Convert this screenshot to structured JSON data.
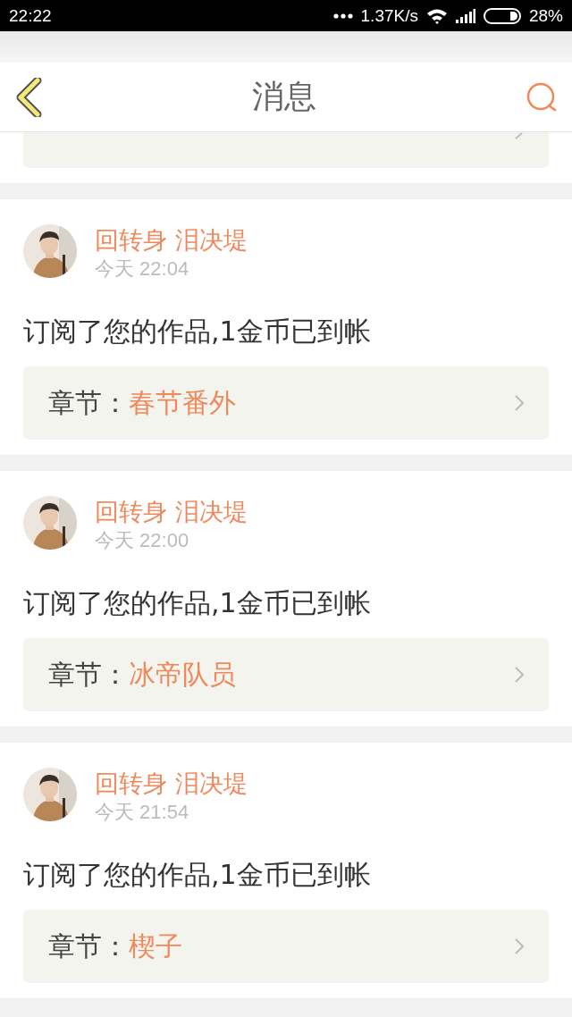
{
  "status_bar": {
    "time": "22:22",
    "network_speed": "1.37K/s",
    "battery": "28%"
  },
  "header": {
    "title": "消息"
  },
  "messages": [
    {
      "user": "回转身 泪决堤",
      "time": "今天 22:04",
      "text": "订阅了您的作品,1金币已到帐",
      "chapter_label": "章节：",
      "chapter_title": "春节番外"
    },
    {
      "user": "回转身 泪决堤",
      "time": "今天 22:00",
      "text": "订阅了您的作品,1金币已到帐",
      "chapter_label": "章节：",
      "chapter_title": "冰帝队员"
    },
    {
      "user": "回转身 泪决堤",
      "time": "今天 21:54",
      "text": "订阅了您的作品,1金币已到帐",
      "chapter_label": "章节：",
      "chapter_title": "楔子"
    }
  ]
}
